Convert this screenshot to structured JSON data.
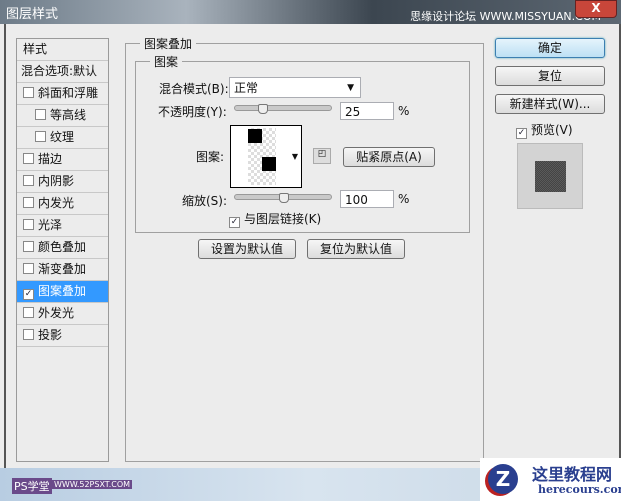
{
  "window": {
    "title": "图层样式",
    "watermark_top": "思缘设计论坛 WWW.MISSYUAN.COM",
    "close": "X"
  },
  "sidebar": {
    "header": "样式",
    "blend_options": "混合选项:默认",
    "items": [
      {
        "label": "斜面和浮雕",
        "checked": false,
        "indent": false
      },
      {
        "label": "等高线",
        "checked": false,
        "indent": true
      },
      {
        "label": "纹理",
        "checked": false,
        "indent": true
      },
      {
        "label": "描边",
        "checked": false,
        "indent": false
      },
      {
        "label": "内阴影",
        "checked": false,
        "indent": false
      },
      {
        "label": "内发光",
        "checked": false,
        "indent": false
      },
      {
        "label": "光泽",
        "checked": false,
        "indent": false
      },
      {
        "label": "颜色叠加",
        "checked": false,
        "indent": false
      },
      {
        "label": "渐变叠加",
        "checked": false,
        "indent": false
      },
      {
        "label": "图案叠加",
        "checked": true,
        "indent": false,
        "selected": true
      },
      {
        "label": "外发光",
        "checked": false,
        "indent": false
      },
      {
        "label": "投影",
        "checked": false,
        "indent": false
      }
    ]
  },
  "panel": {
    "group_title": "图案叠加",
    "sub_title": "图案",
    "blend_label": "混合模式(B):",
    "blend_value": "正常",
    "opacity_label": "不透明度(Y):",
    "opacity_value": "25",
    "opacity_unit": "%",
    "opacity_fraction": 0.25,
    "pattern_label": "图案:",
    "snap_button": "贴紧原点(A)",
    "scale_label": "缩放(S):",
    "scale_value": "100",
    "scale_unit": "%",
    "link_label": "与图层链接(K)",
    "link_checked": true,
    "set_default": "设置为默认值",
    "reset_default": "复位为默认值"
  },
  "actions": {
    "ok": "确定",
    "reset": "复位",
    "new_style": "新建样式(W)...",
    "preview_label": "预览(V)",
    "preview_checked": true
  },
  "footer": {
    "wm_left": "PS学堂",
    "wm_left_url": "WWW.52PSXT.COM",
    "wm_right": "这里教程网",
    "wm_right_url": "herecours.com"
  }
}
